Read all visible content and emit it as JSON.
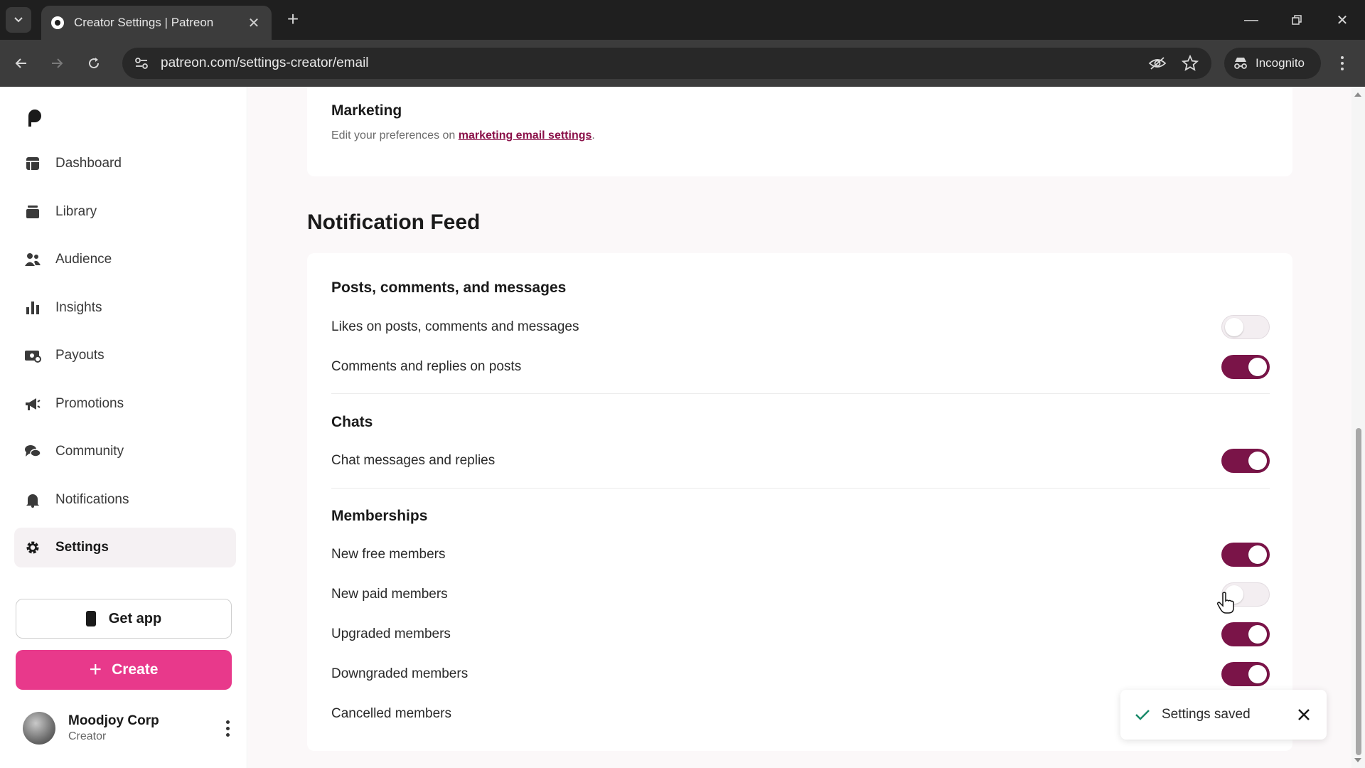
{
  "browser": {
    "tab_title": "Creator Settings | Patreon",
    "url": "patreon.com/settings-creator/email",
    "incognito_label": "Incognito"
  },
  "sidebar": {
    "items": [
      {
        "label": "Dashboard",
        "icon": "dashboard-icon"
      },
      {
        "label": "Library",
        "icon": "library-icon"
      },
      {
        "label": "Audience",
        "icon": "audience-icon"
      },
      {
        "label": "Insights",
        "icon": "insights-icon"
      },
      {
        "label": "Payouts",
        "icon": "payouts-icon"
      },
      {
        "label": "Promotions",
        "icon": "promotions-icon"
      },
      {
        "label": "Community",
        "icon": "community-icon"
      },
      {
        "label": "Notifications",
        "icon": "bell-icon"
      },
      {
        "label": "Settings",
        "icon": "gear-icon",
        "active": true
      }
    ],
    "get_app_label": "Get app",
    "create_label": "Create",
    "profile": {
      "name": "Moodjoy Corp",
      "role": "Creator"
    }
  },
  "main": {
    "marketing": {
      "title": "Marketing",
      "text_before": "Edit your preferences on ",
      "link_text": "marketing email settings",
      "text_after": "."
    },
    "notification_feed": {
      "heading": "Notification Feed",
      "groups": [
        {
          "title": "Posts, comments, and messages",
          "items": [
            {
              "label": "Likes on posts, comments and messages",
              "enabled": false
            },
            {
              "label": "Comments and replies on posts",
              "enabled": true
            }
          ]
        },
        {
          "title": "Chats",
          "items": [
            {
              "label": "Chat messages and replies",
              "enabled": true
            }
          ]
        },
        {
          "title": "Memberships",
          "items": [
            {
              "label": "New free members",
              "enabled": true
            },
            {
              "label": "New paid members",
              "enabled": false
            },
            {
              "label": "Upgraded members",
              "enabled": true
            },
            {
              "label": "Downgraded members",
              "enabled": true
            },
            {
              "label": "Cancelled members"
            }
          ]
        }
      ]
    }
  },
  "toast": {
    "text": "Settings saved"
  },
  "colors": {
    "brand_pink": "#e8398b",
    "toggle_on": "#7a1448",
    "link": "#8a1048"
  }
}
